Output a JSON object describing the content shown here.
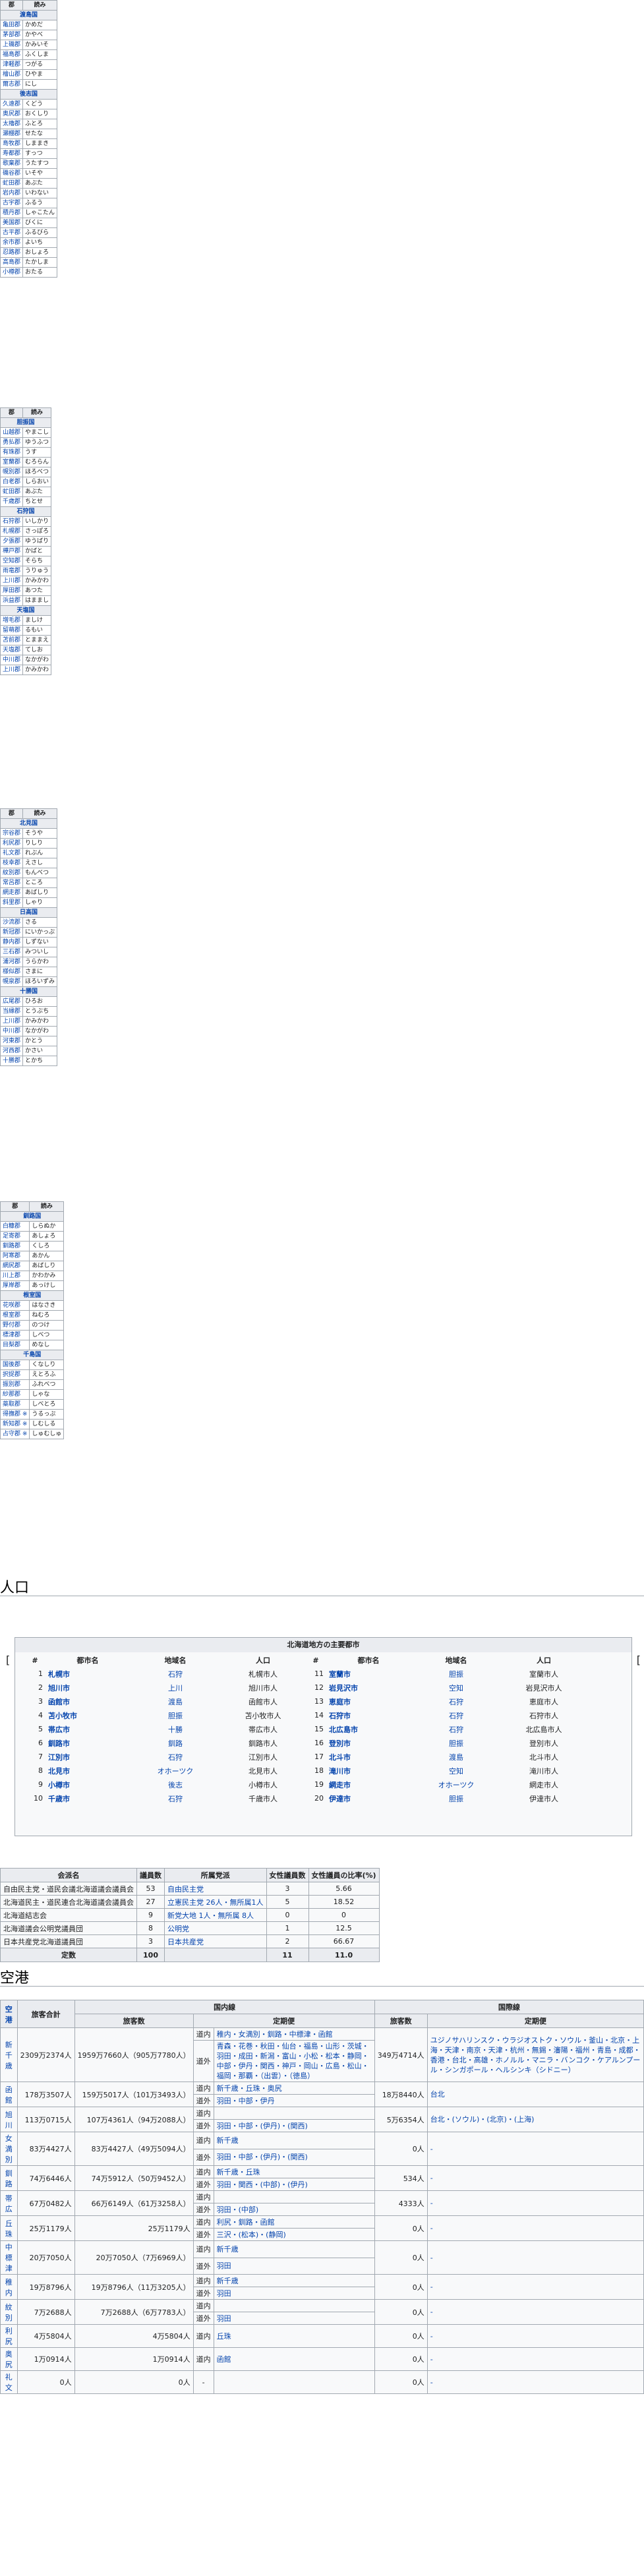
{
  "district_tables": [
    {
      "header": [
        "郡",
        "読み"
      ],
      "sections": [
        {
          "title": "渡島国",
          "rows": [
            [
              "亀田郡",
              "かめだ"
            ],
            [
              "茅部郡",
              "かやべ"
            ],
            [
              "上磯郡",
              "かみいそ"
            ],
            [
              "福島郡",
              "ふくしま"
            ],
            [
              "津軽郡",
              "つがる"
            ],
            [
              "檜山郡",
              "ひやま"
            ],
            [
              "爾志郡",
              "にし"
            ]
          ]
        },
        {
          "title": "後志国",
          "rows": [
            [
              "久遠郡",
              "くどう"
            ],
            [
              "奥尻郡",
              "おくしり"
            ],
            [
              "太櫓郡",
              "ふとろ"
            ],
            [
              "瀬棚郡",
              "せたな"
            ],
            [
              "島牧郡",
              "しままき"
            ],
            [
              "寿都郡",
              "すっつ"
            ],
            [
              "歌棄郡",
              "うたすつ"
            ],
            [
              "磯谷郡",
              "いそや"
            ],
            [
              "虻田郡",
              "あぶた"
            ],
            [
              "岩内郡",
              "いわない"
            ],
            [
              "古宇郡",
              "ふるう"
            ],
            [
              "積丹郡",
              "しゃこたん"
            ],
            [
              "美国郡",
              "びくに"
            ],
            [
              "古平郡",
              "ふるびら"
            ],
            [
              "余市郡",
              "よいち"
            ],
            [
              "忍路郡",
              "おしょろ"
            ],
            [
              "高島郡",
              "たかしま"
            ],
            [
              "小樽郡",
              "おたる"
            ]
          ]
        }
      ]
    },
    {
      "header": [
        "郡",
        "読み"
      ],
      "sections": [
        {
          "title": "胆振国",
          "rows": [
            [
              "山越郡",
              "やまこし"
            ],
            [
              "勇払郡",
              "ゆうふつ"
            ],
            [
              "有珠郡",
              "うす"
            ],
            [
              "室蘭郡",
              "むろらん"
            ],
            [
              "幌別郡",
              "ほろべつ"
            ],
            [
              "白老郡",
              "しらおい"
            ],
            [
              "虻田郡",
              "あぶた"
            ],
            [
              "千歳郡",
              "ちとせ"
            ]
          ]
        },
        {
          "title": "石狩国",
          "rows": [
            [
              "石狩郡",
              "いしかり"
            ],
            [
              "札幌郡",
              "さっぽろ"
            ],
            [
              "夕張郡",
              "ゆうばり"
            ],
            [
              "樺戸郡",
              "かばと"
            ],
            [
              "空知郡",
              "そらち"
            ],
            [
              "雨竜郡",
              "うりゅう"
            ],
            [
              "上川郡",
              "かみかわ"
            ],
            [
              "厚田郡",
              "あつた"
            ],
            [
              "浜益郡",
              "はままし"
            ]
          ]
        },
        {
          "title": "天塩国",
          "rows": [
            [
              "増毛郡",
              "ましけ"
            ],
            [
              "留萌郡",
              "るもい"
            ],
            [
              "苫前郡",
              "とままえ"
            ],
            [
              "天塩郡",
              "てしお"
            ],
            [
              "中川郡",
              "なかがわ"
            ],
            [
              "上川郡",
              "かみかわ"
            ]
          ]
        }
      ]
    },
    {
      "header": [
        "郡",
        "読み"
      ],
      "sections": [
        {
          "title": "北見国",
          "rows": [
            [
              "宗谷郡",
              "そうや"
            ],
            [
              "利尻郡",
              "りしり"
            ],
            [
              "礼文郡",
              "れぶん"
            ],
            [
              "枝幸郡",
              "えさし"
            ],
            [
              "紋別郡",
              "もんべつ"
            ],
            [
              "常呂郡",
              "ところ"
            ],
            [
              "網走郡",
              "あばしり"
            ],
            [
              "斜里郡",
              "しゃり"
            ]
          ]
        },
        {
          "title": "日高国",
          "rows": [
            [
              "沙流郡",
              "さる"
            ],
            [
              "新冠郡",
              "にいかっぷ"
            ],
            [
              "静内郡",
              "しずない"
            ],
            [
              "三石郡",
              "みついし"
            ],
            [
              "浦河郡",
              "うらかわ"
            ],
            [
              "様似郡",
              "さまに"
            ],
            [
              "幌泉郡",
              "ほろいずみ"
            ]
          ]
        },
        {
          "title": "十勝国",
          "rows": [
            [
              "広尾郡",
              "ひろお"
            ],
            [
              "当縁郡",
              "とうぶち"
            ],
            [
              "上川郡",
              "かみかわ"
            ],
            [
              "中川郡",
              "なかがわ"
            ],
            [
              "河東郡",
              "かとう"
            ],
            [
              "河西郡",
              "かさい"
            ],
            [
              "十勝郡",
              "とかち"
            ]
          ]
        }
      ]
    },
    {
      "header": [
        "郡",
        "読み"
      ],
      "sections": [
        {
          "title": "釧路国",
          "rows": [
            [
              "白糠郡",
              "しらぬか"
            ],
            [
              "足寄郡",
              "あしょろ"
            ],
            [
              "釧路郡",
              "くしろ"
            ],
            [
              "阿寒郡",
              "あかん"
            ],
            [
              "網尻郡",
              "あばしり"
            ],
            [
              "川上郡",
              "かわかみ"
            ],
            [
              "厚岸郡",
              "あっけし"
            ]
          ]
        },
        {
          "title": "根室国",
          "rows": [
            [
              "花咲郡",
              "はなさき"
            ],
            [
              "根室郡",
              "ねむろ"
            ],
            [
              "野付郡",
              "のつけ"
            ],
            [
              "標津郡",
              "しべつ"
            ],
            [
              "目梨郡",
              "めなし"
            ]
          ]
        },
        {
          "title": "千島国",
          "rows": [
            [
              "国後郡",
              "くなしり"
            ],
            [
              "択捉郡",
              "えとろふ"
            ],
            [
              "振別郡",
              "ふれべつ"
            ],
            [
              "紗那郡",
              "しゃな"
            ],
            [
              "蘂取郡",
              "しべとろ"
            ],
            [
              "得撫郡 ※",
              "うるっぷ"
            ],
            [
              "新知郡 ※",
              "しむしる"
            ],
            [
              "占守郡 ※",
              "しゅむしゅ"
            ]
          ]
        }
      ]
    }
  ],
  "population_heading": "人口",
  "cities": {
    "caption": "北海道地方の主要都市",
    "headers": [
      "#",
      "都市名",
      "地域名",
      "人口",
      "#",
      "都市名",
      "地域名",
      "人口"
    ],
    "left": [
      [
        "1",
        "札幌市",
        "石狩",
        "札幌市人"
      ],
      [
        "2",
        "旭川市",
        "上川",
        "旭川市人"
      ],
      [
        "3",
        "函館市",
        "渡島",
        "函館市人"
      ],
      [
        "4",
        "苫小牧市",
        "胆振",
        "苫小牧市人"
      ],
      [
        "5",
        "帯広市",
        "十勝",
        "帯広市人"
      ],
      [
        "6",
        "釧路市",
        "釧路",
        "釧路市人"
      ],
      [
        "7",
        "江別市",
        "石狩",
        "江別市人"
      ],
      [
        "8",
        "北見市",
        "オホーツク",
        "北見市人"
      ],
      [
        "9",
        "小樽市",
        "後志",
        "小樽市人"
      ],
      [
        "10",
        "千歳市",
        "石狩",
        "千歳市人"
      ]
    ],
    "right": [
      [
        "11",
        "室蘭市",
        "胆振",
        "室蘭市人"
      ],
      [
        "12",
        "岩見沢市",
        "空知",
        "岩見沢市人"
      ],
      [
        "13",
        "恵庭市",
        "石狩",
        "恵庭市人"
      ],
      [
        "14",
        "石狩市",
        "石狩",
        "石狩市人"
      ],
      [
        "15",
        "北広島市",
        "石狩",
        "北広島市人"
      ],
      [
        "16",
        "登別市",
        "胆振",
        "登別市人"
      ],
      [
        "17",
        "北斗市",
        "渡島",
        "北斗市人"
      ],
      [
        "18",
        "滝川市",
        "空知",
        "滝川市人"
      ],
      [
        "19",
        "網走市",
        "オホーツク",
        "網走市人"
      ],
      [
        "20",
        "伊達市",
        "胆振",
        "伊達市人"
      ]
    ],
    "nav_left": "[",
    "nav_right": "["
  },
  "assembly": {
    "headers": [
      "会派名",
      "議員数",
      "所属党派",
      "女性議員数",
      "女性議員の比率(%)"
    ],
    "rows": [
      [
        "自由民主党・道民会議北海道議会議員会",
        "53",
        "自由民主党",
        "3",
        "5.66"
      ],
      [
        "北海道民主・道民連合北海道議会議員会",
        "27",
        "立憲民主党 26人・無所属1人",
        "5",
        "18.52"
      ],
      [
        "北海道結志会",
        "9",
        "新党大地 1人・無所属 8人",
        "0",
        "0"
      ],
      [
        "北海道議会公明党議員団",
        "8",
        "公明党",
        "1",
        "12.5"
      ],
      [
        "日本共産党北海道議員団",
        "3",
        "日本共産党",
        "2",
        "66.67"
      ]
    ],
    "total": [
      "定数",
      "100",
      "",
      "11",
      "11.0"
    ]
  },
  "airports_heading": "空港",
  "airports": {
    "h_airport": "空港",
    "h_total": "旅客合計",
    "h_domestic": "国内線",
    "h_international": "国際線",
    "h_passengers": "旅客数",
    "h_routes": "定期便",
    "rows": [
      {
        "name": "新千歳",
        "total": "2309万2374人",
        "dom": "1959万7660人（905万7780人）",
        "routes": [
          {
            "k": "道内",
            "v": "稚内・女満別・釧路・中標津・函館"
          },
          {
            "k": "道外",
            "v": "青森・花巻・秋田・仙台・福島・山形・茨城・羽田・成田・新潟・富山・小松・松本・静岡・中部・伊丹・関西・神戸・岡山・広島・松山・福岡・那覇・（出雲）・（徳島）"
          }
        ],
        "intl": "349万4714人",
        "intl_routes": "ユジノサハリンスク・ウラジオストク・ソウル・釜山・北京・上海・天津・南京・天津・杭州・無錫・瀋陽・福州・青島・成都・香港・台北・高雄・ホノルル・マニラ・バンコク・ケアルンプール・シンガポール・ヘルシンキ（シドニー）"
      },
      {
        "name": "函館",
        "total": "178万3507人",
        "dom": "159万5017人（101万3493人）",
        "routes": [
          {
            "k": "道内",
            "v": "新千歳・丘珠・奥尻"
          },
          {
            "k": "道外",
            "v": "羽田・中部・伊丹"
          }
        ],
        "intl": "18万8440人",
        "intl_routes": "台北"
      },
      {
        "name": "旭川",
        "total": "113万0715人",
        "dom": "107万4361人（94万2088人）",
        "routes": [
          {
            "k": "道内",
            "v": ""
          },
          {
            "k": "道外",
            "v": "羽田・中部・(伊丹)・(関西)"
          }
        ],
        "intl": "5万6354人",
        "intl_routes": "台北・(ソウル)・(北京)・(上海)"
      },
      {
        "name": "女満別",
        "total": "83万4427人",
        "dom": "83万4427人（49万5094人）",
        "routes": [
          {
            "k": "道内",
            "v": "新千歳"
          },
          {
            "k": "道外",
            "v": "羽田・中部・(伊丹)・(関西)"
          }
        ],
        "intl": "0人",
        "intl_routes": "-"
      },
      {
        "name": "釧路",
        "total": "74万6446人",
        "dom": "74万5912人（50万9452人）",
        "routes": [
          {
            "k": "道内",
            "v": "新千歳・丘珠"
          },
          {
            "k": "道外",
            "v": "羽田・関西・(中部)・(伊丹)"
          }
        ],
        "intl": "534人",
        "intl_routes": "-"
      },
      {
        "name": "帯広",
        "total": "67万0482人",
        "dom": "66万6149人（61万3258人）",
        "routes": [
          {
            "k": "道内",
            "v": ""
          },
          {
            "k": "道外",
            "v": "羽田・(中部)"
          }
        ],
        "intl": "4333人",
        "intl_routes": "-"
      },
      {
        "name": "丘珠",
        "total": "25万1179人",
        "dom": "25万1179人",
        "routes": [
          {
            "k": "道内",
            "v": "利尻・釧路・函館"
          },
          {
            "k": "道外",
            "v": "三沢・(松本)・(静岡)"
          }
        ],
        "intl": "0人",
        "intl_routes": "-"
      },
      {
        "name": "中標津",
        "total": "20万7050人",
        "dom": "20万7050人（7万6969人）",
        "routes": [
          {
            "k": "道内",
            "v": "新千歳"
          },
          {
            "k": "道外",
            "v": "羽田"
          }
        ],
        "intl": "0人",
        "intl_routes": "-"
      },
      {
        "name": "稚内",
        "total": "19万8796人",
        "dom": "19万8796人（11万3205人）",
        "routes": [
          {
            "k": "道内",
            "v": "新千歳"
          },
          {
            "k": "道外",
            "v": "羽田"
          }
        ],
        "intl": "0人",
        "intl_routes": "-"
      },
      {
        "name": "紋別",
        "total": "7万2688人",
        "dom": "7万2688人（6万7783人）",
        "routes": [
          {
            "k": "道内",
            "v": ""
          },
          {
            "k": "道外",
            "v": "羽田"
          }
        ],
        "intl": "0人",
        "intl_routes": "-"
      },
      {
        "name": "利尻",
        "total": "4万5804人",
        "dom": "4万5804人",
        "routes": [
          {
            "k": "道内",
            "v": "丘珠"
          }
        ],
        "intl": "0人",
        "intl_routes": "-"
      },
      {
        "name": "奥尻",
        "total": "1万0914人",
        "dom": "1万0914人",
        "routes": [
          {
            "k": "道内",
            "v": "函館"
          }
        ],
        "intl": "0人",
        "intl_routes": "-"
      },
      {
        "name": "礼文",
        "total": "0人",
        "dom": "0人",
        "routes": [
          {
            "k": "-",
            "v": ""
          }
        ],
        "intl": "0人",
        "intl_routes": "-"
      }
    ]
  }
}
